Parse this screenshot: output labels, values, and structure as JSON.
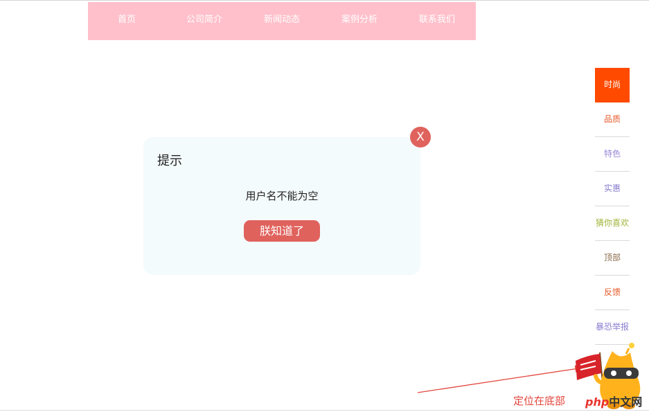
{
  "nav": {
    "items": [
      "首页",
      "公司简介",
      "新闻动态",
      "案例分析",
      "联系我们"
    ]
  },
  "sidebar": {
    "items": [
      {
        "label": "时尚",
        "color": "#ffffff",
        "active": true
      },
      {
        "label": "品质",
        "color": "#e85a2a"
      },
      {
        "label": "特色",
        "color": "#9a88d6"
      },
      {
        "label": "实惠",
        "color": "#8a7fd0"
      },
      {
        "label": "猜你喜欢",
        "color": "#a0b43a"
      },
      {
        "label": "顶部",
        "color": "#8a6a4a"
      },
      {
        "label": "反馈",
        "color": "#e85a2a"
      },
      {
        "label": "暴恐举报",
        "color": "#8a7fd0"
      }
    ]
  },
  "dialog": {
    "title": "提示",
    "message": "用户名不能为空",
    "ok_label": "朕知道了",
    "close_label": "X"
  },
  "annotation": {
    "text": "定位在底部"
  },
  "watermark": {
    "php": "php",
    "cn": "中文网"
  },
  "colors": {
    "nav_bg": "#ffc0cb",
    "active_bg": "#ff4a00",
    "accent": "#e0625d",
    "annotation": "#e2453c"
  }
}
